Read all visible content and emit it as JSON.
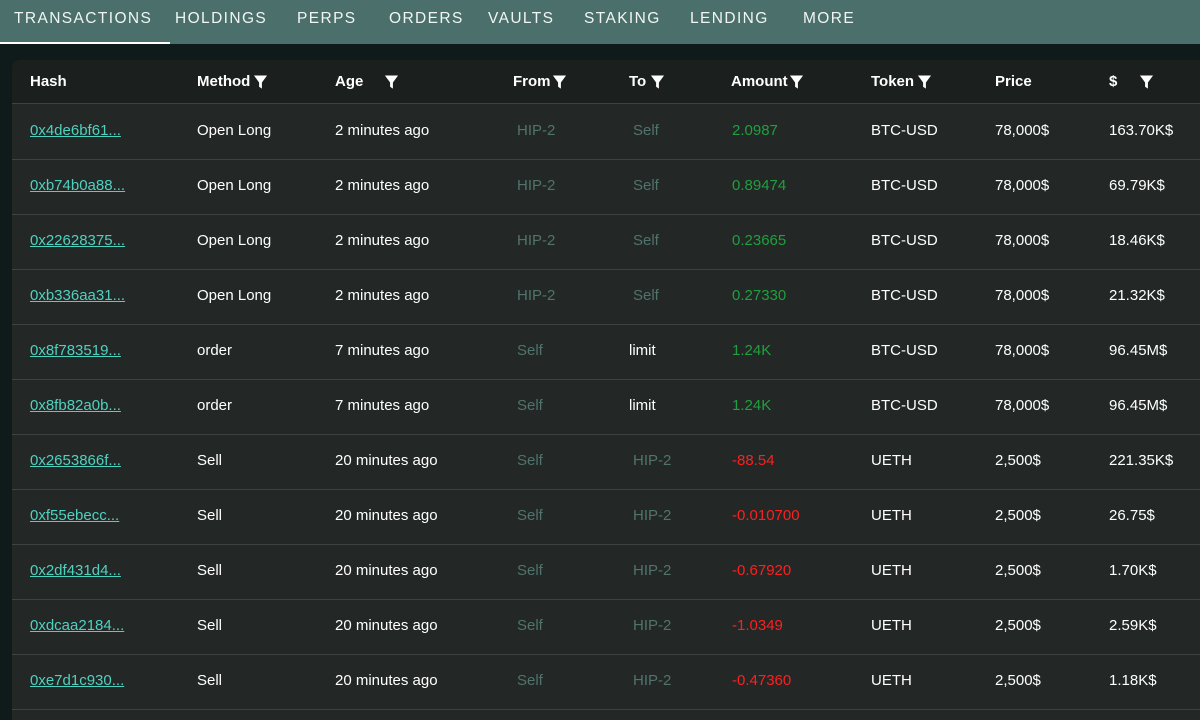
{
  "tabs": [
    {
      "label": "TRANSACTIONS",
      "active": true
    },
    {
      "label": "HOLDINGS"
    },
    {
      "label": "PERPS"
    },
    {
      "label": "ORDERS"
    },
    {
      "label": "VAULTS"
    },
    {
      "label": "STAKING"
    },
    {
      "label": "LENDING"
    },
    {
      "label": "MORE"
    }
  ],
  "columns": {
    "hash": "Hash",
    "method": "Method",
    "age": "Age",
    "from": "From",
    "to": "To",
    "amount": "Amount",
    "token": "Token",
    "price": "Price",
    "usd": "$"
  },
  "colors": {
    "accent": "#4fd1c0",
    "positive": "#1f9f3f",
    "negative": "#ff1f1f",
    "muted": "#50736b",
    "tab_bar": "#4b6f6a"
  },
  "rows": [
    {
      "hash": "0x4de6bf61...",
      "method": "Open Long",
      "age": "2 minutes ago",
      "from": "HIP-2",
      "to": "Self",
      "amount": "2.0987",
      "token": "BTC-USD",
      "price": "78,000$",
      "usd": "163.70K$"
    },
    {
      "hash": "0xb74b0a88...",
      "method": "Open Long",
      "age": "2 minutes ago",
      "from": "HIP-2",
      "to": "Self",
      "amount": "0.89474",
      "token": "BTC-USD",
      "price": "78,000$",
      "usd": "69.79K$"
    },
    {
      "hash": "0x22628375...",
      "method": "Open Long",
      "age": "2 minutes ago",
      "from": "HIP-2",
      "to": "Self",
      "amount": "0.23665",
      "token": "BTC-USD",
      "price": "78,000$",
      "usd": "18.46K$"
    },
    {
      "hash": "0xb336aa31...",
      "method": "Open Long",
      "age": "2 minutes ago",
      "from": "HIP-2",
      "to": "Self",
      "amount": "0.27330",
      "token": "BTC-USD",
      "price": "78,000$",
      "usd": "21.32K$"
    },
    {
      "hash": "0x8f783519...",
      "method": "order",
      "age": "7 minutes ago",
      "from": "Self",
      "to": "limit",
      "amount": "1.24K",
      "token": "BTC-USD",
      "price": "78,000$",
      "usd": "96.45M$"
    },
    {
      "hash": "0x8fb82a0b...",
      "method": "order",
      "age": "7 minutes ago",
      "from": "Self",
      "to": "limit",
      "amount": "1.24K",
      "token": "BTC-USD",
      "price": "78,000$",
      "usd": "96.45M$"
    },
    {
      "hash": "0x2653866f...",
      "method": "Sell",
      "age": "20 minutes ago",
      "from": "Self",
      "to": "HIP-2",
      "amount": "-88.54",
      "token": "UETH",
      "price": "2,500$",
      "usd": "221.35K$"
    },
    {
      "hash": "0xf55ebecc...",
      "method": "Sell",
      "age": "20 minutes ago",
      "from": "Self",
      "to": "HIP-2",
      "amount": "-0.010700",
      "token": "UETH",
      "price": "2,500$",
      "usd": "26.75$"
    },
    {
      "hash": "0x2df431d4...",
      "method": "Sell",
      "age": "20 minutes ago",
      "from": "Self",
      "to": "HIP-2",
      "amount": "-0.67920",
      "token": "UETH",
      "price": "2,500$",
      "usd": "1.70K$"
    },
    {
      "hash": "0xdcaa2184...",
      "method": "Sell",
      "age": "20 minutes ago",
      "from": "Self",
      "to": "HIP-2",
      "amount": "-1.0349",
      "token": "UETH",
      "price": "2,500$",
      "usd": "2.59K$"
    },
    {
      "hash": "0xe7d1c930...",
      "method": "Sell",
      "age": "20 minutes ago",
      "from": "Self",
      "to": "HIP-2",
      "amount": "-0.47360",
      "token": "UETH",
      "price": "2,500$",
      "usd": "1.18K$"
    }
  ]
}
